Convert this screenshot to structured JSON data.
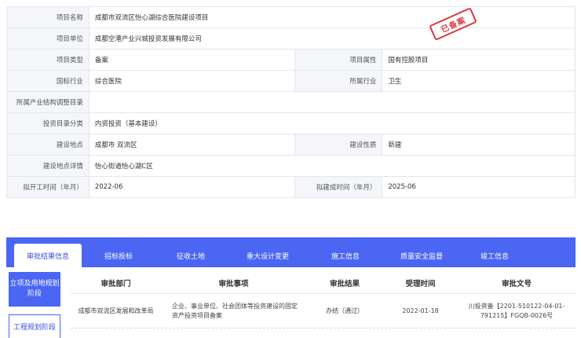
{
  "project_info": {
    "project_name_label": "项目名称",
    "project_name": "成都市双流区怡心湖综合医院建设项目",
    "project_unit_label": "项目单位",
    "project_unit": "成都空港产业兴城投资发展有限公司",
    "project_type_label": "项目类型",
    "project_type": "备案",
    "project_attr_label": "项目属性",
    "project_attr": "国有控股项目",
    "national_industry_label": "国标行业",
    "national_industry": "综合医院",
    "industry_label": "所属行业",
    "industry": "卫生",
    "structure_catalog_label": "所属产业结构调整目录",
    "structure_catalog": "",
    "investment_catalog_label": "投资目录分类",
    "investment_catalog": "内资投资（基本建设）",
    "location_label": "建设地点",
    "location": "成都市 双流区",
    "nature_label": "建设性质",
    "nature": "新建",
    "location_detail_label": "建设地点详情",
    "location_detail": "怡心街道怡心湖C区",
    "start_time_label": "拟开工时间（年月）",
    "start_time": "2022-06",
    "end_time_label": "拟建成时间（年月）",
    "end_time": "2025-06"
  },
  "stamp_text": "已备案",
  "tabs": [
    {
      "label": "审批结果信息"
    },
    {
      "label": "招标投标"
    },
    {
      "label": "征收土地"
    },
    {
      "label": "重大设计变更"
    },
    {
      "label": "施工信息"
    },
    {
      "label": "质量安全监督"
    },
    {
      "label": "竣工信息"
    }
  ],
  "sidebar": {
    "items": [
      {
        "label": "立项及用地规划阶段"
      },
      {
        "label": "工程规划阶段"
      }
    ]
  },
  "approval_table": {
    "headers": [
      "审批部门",
      "审批事项",
      "审批结果",
      "受理时间",
      "审批文号"
    ],
    "rows": [
      {
        "department": "成都市双流区发展和改革局",
        "item": "企业、事业单位、社会团体等投资建设的固定资产投资项目备案",
        "result": "办结（通过）",
        "accept_time": "2022-01-18",
        "doc_no": "川投资备【2201-510122-04-01-791215】FGQB-0026号"
      }
    ]
  },
  "colors": {
    "accent": "#4a66f3",
    "label_bg": "#f4f6fa",
    "stamp": "#d9363e"
  }
}
